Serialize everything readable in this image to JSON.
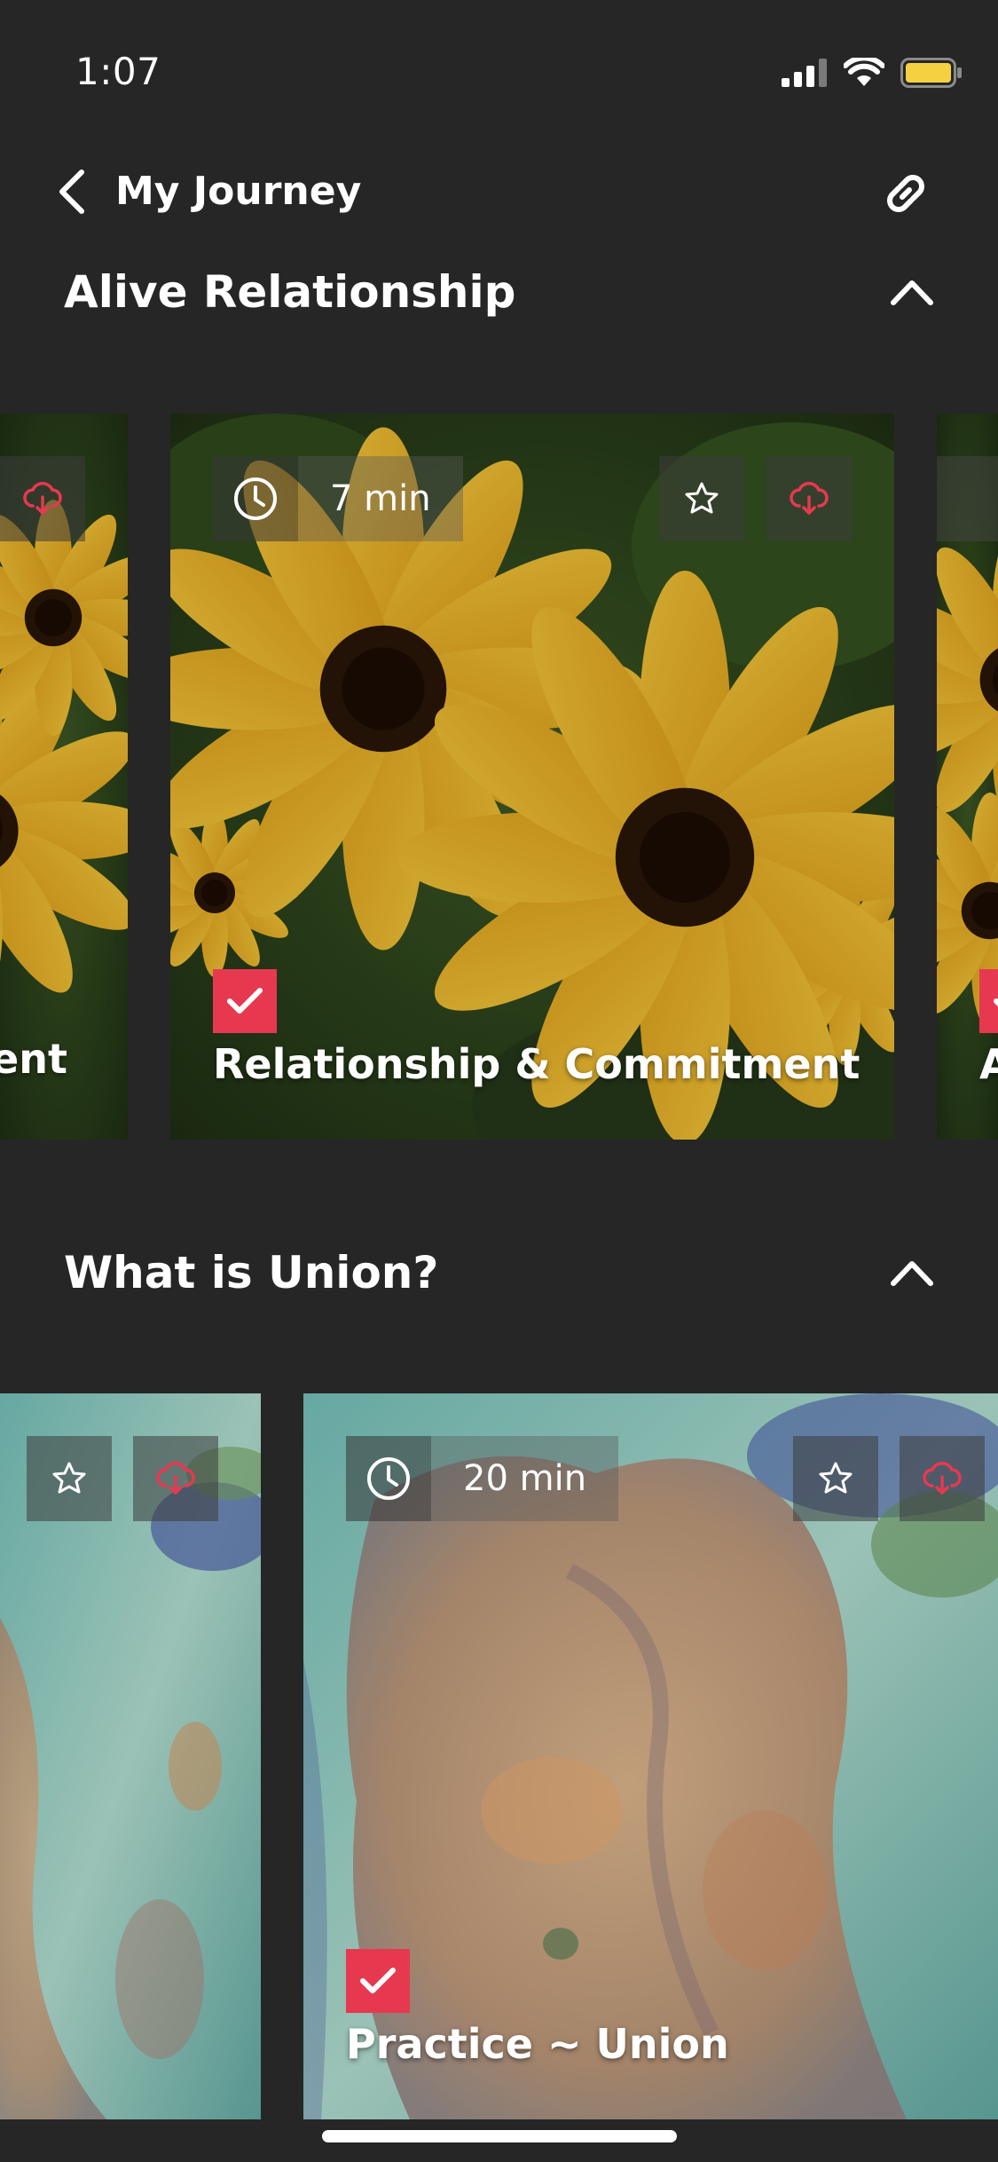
{
  "status_bar": {
    "time": "1:07",
    "icons": [
      "signal-icon",
      "wifi-icon",
      "battery-icon"
    ],
    "battery_color": "#f5d142"
  },
  "nav": {
    "back_icon": "chevron-left-icon",
    "title": "My Journey",
    "link_icon": "link-icon"
  },
  "colors": {
    "background": "#262626",
    "accent": "#e63950",
    "text": "#ffffff"
  },
  "sections": [
    {
      "title": "Alive Relationship",
      "collapse_icon": "chevron-up-icon",
      "cards": [
        {
          "title_fragment": "ent",
          "completed": true
        },
        {
          "duration": "7 min",
          "title": "Relationship & Commitment",
          "completed": true,
          "favorite_icon": "star-icon",
          "download_icon": "cloud-download-icon"
        },
        {
          "title_fragment": "A",
          "completed": true
        }
      ]
    },
    {
      "title": "What is Union?",
      "collapse_icon": "chevron-up-icon",
      "cards": [
        {
          "favorite_icon": "star-icon",
          "download_icon": "cloud-download-icon"
        },
        {
          "duration": "20 min",
          "title": "Practice ~ Union",
          "completed": true,
          "favorite_icon": "star-icon",
          "download_icon": "cloud-download-icon"
        }
      ]
    }
  ]
}
